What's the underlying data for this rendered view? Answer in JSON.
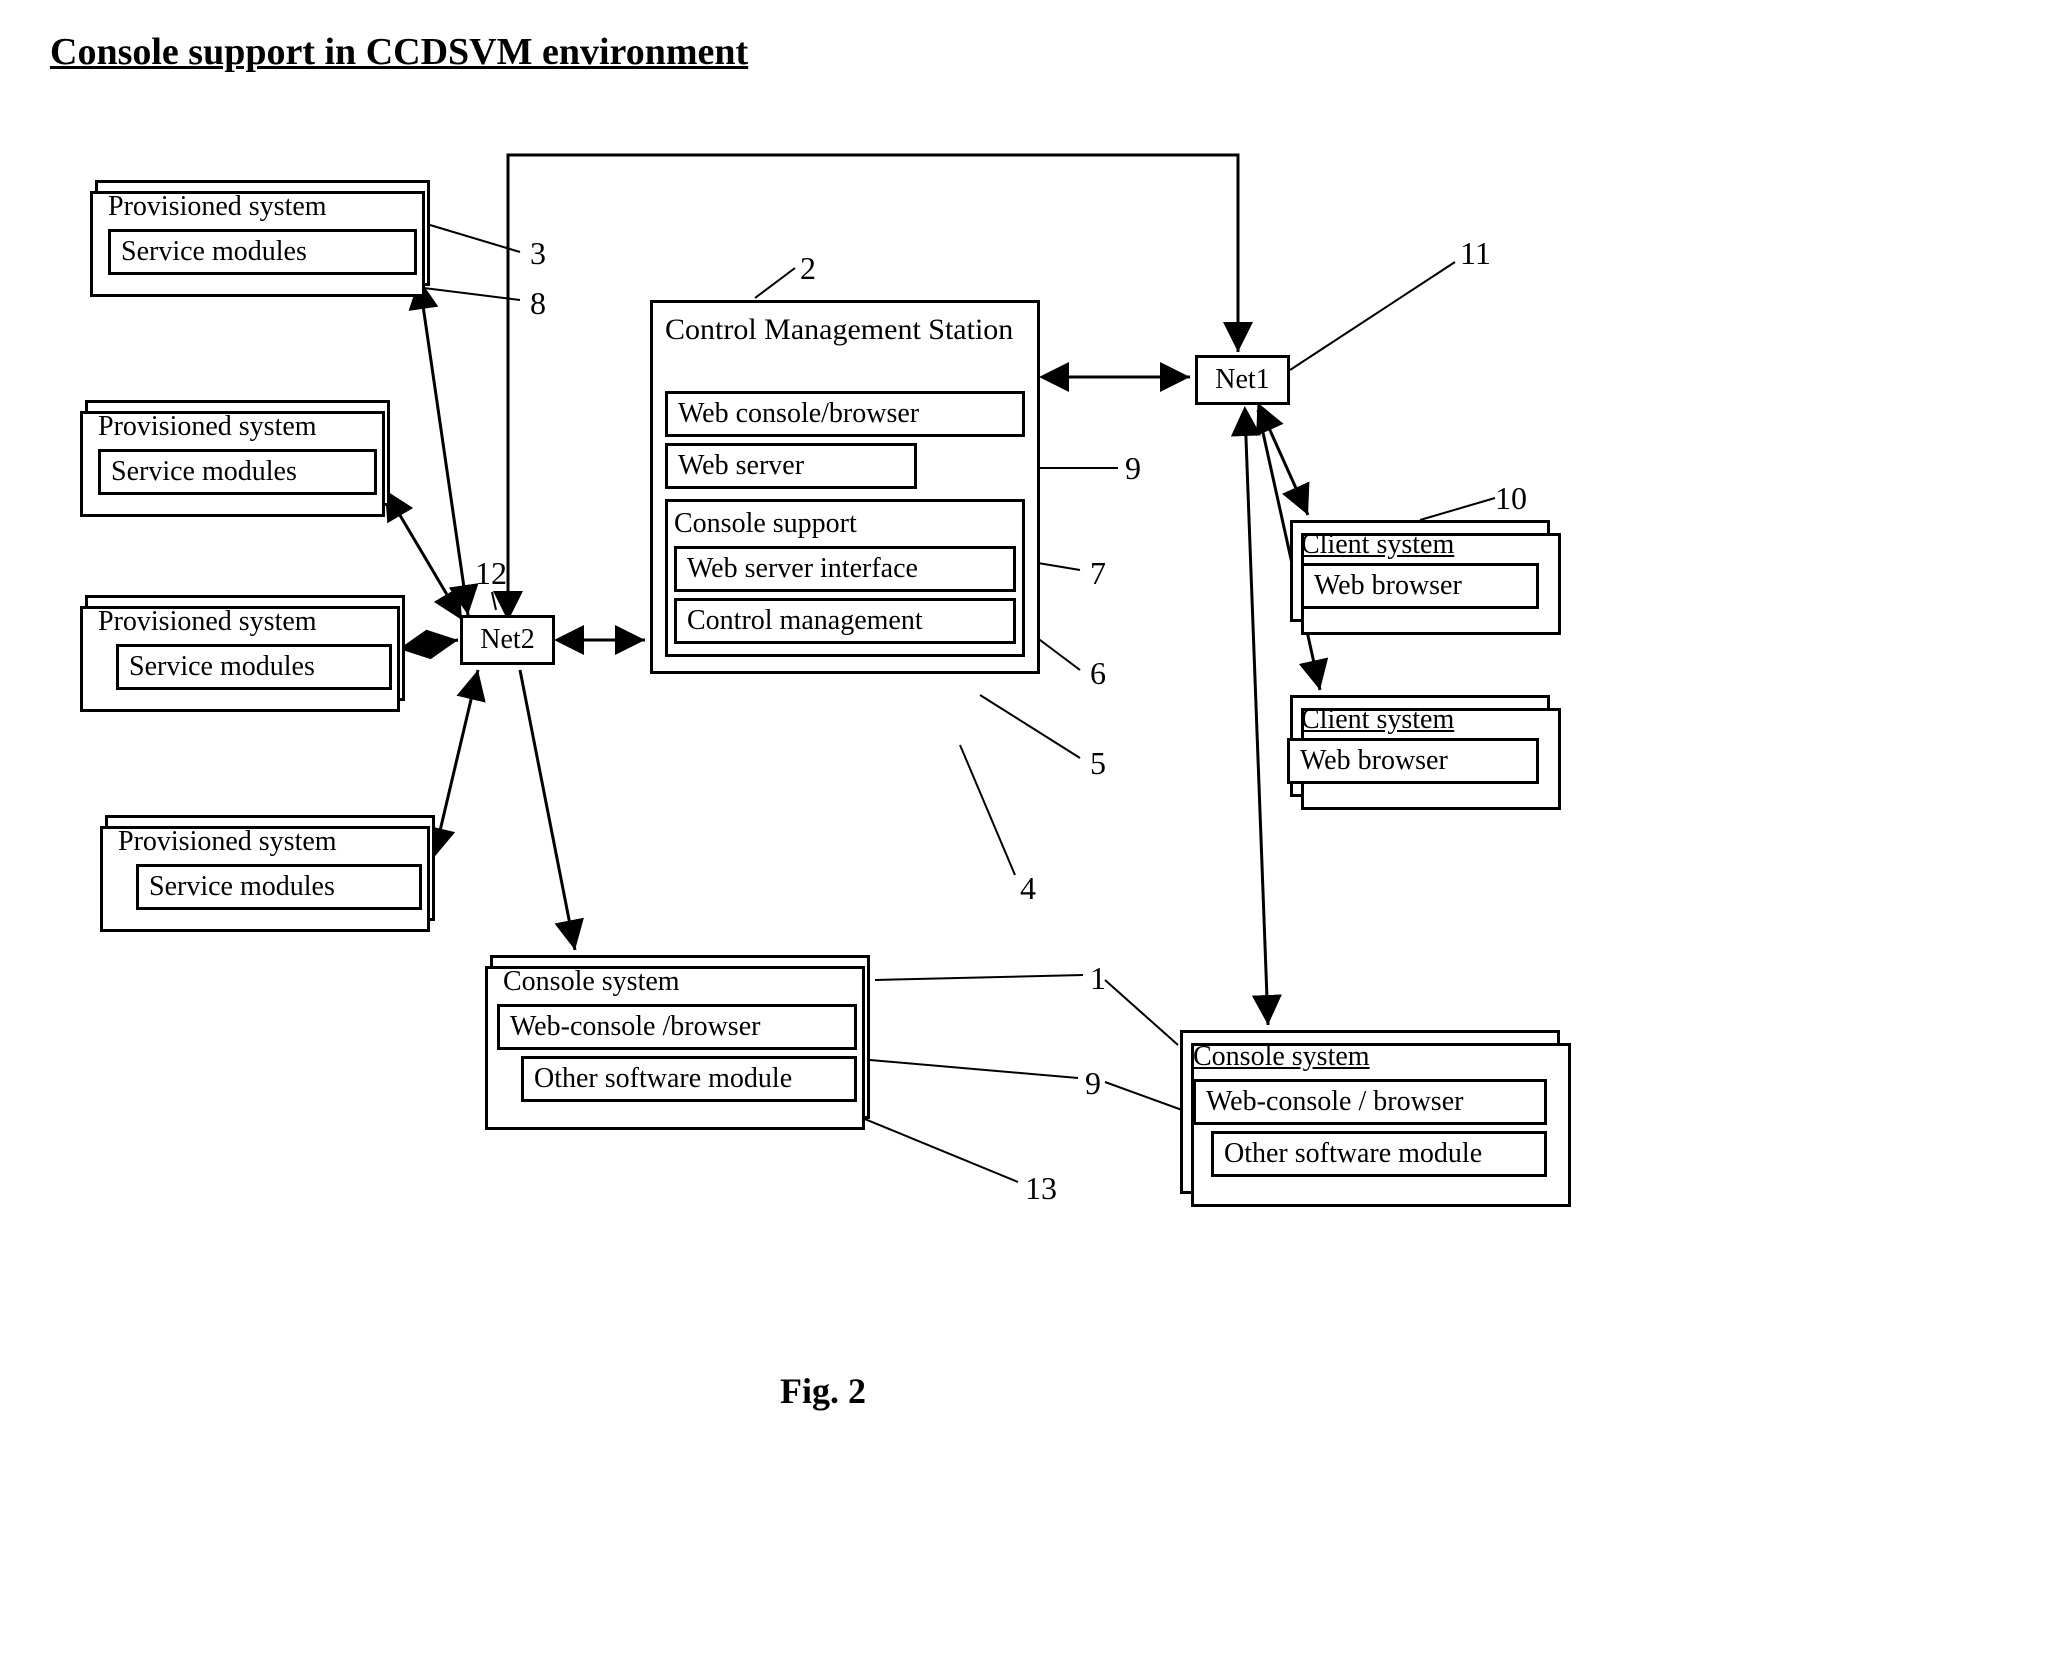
{
  "title": "Console support in CCDSVM environment",
  "figure_label": "Fig.  2",
  "provisioned": {
    "title": "Provisioned system",
    "sub": "Service modules"
  },
  "net2": "Net2",
  "net1": "Net1",
  "cms": {
    "title": "Control Management Station",
    "web_console": "Web console/browser",
    "web_server": "Web server",
    "console_support": "Console support",
    "web_server_if": "Web server interface",
    "ctrl_mgmt": "Control management"
  },
  "client": {
    "title": "Client system",
    "sub": "Web browser"
  },
  "console_a": {
    "title": "Console system",
    "row1": "Web-console /browser",
    "row2": "Other software module"
  },
  "console_b": {
    "title": "Console system",
    "row1": "Web-console / browser",
    "row2": "Other software module"
  },
  "labels": {
    "l1": "1",
    "l2": "2",
    "l3": "3",
    "l4": "4",
    "l5": "5",
    "l6": "6",
    "l7": "7",
    "l8": "8",
    "l9a": "9",
    "l9b": "9",
    "l10": "10",
    "l11": "11",
    "l12": "12",
    "l13": "13"
  }
}
